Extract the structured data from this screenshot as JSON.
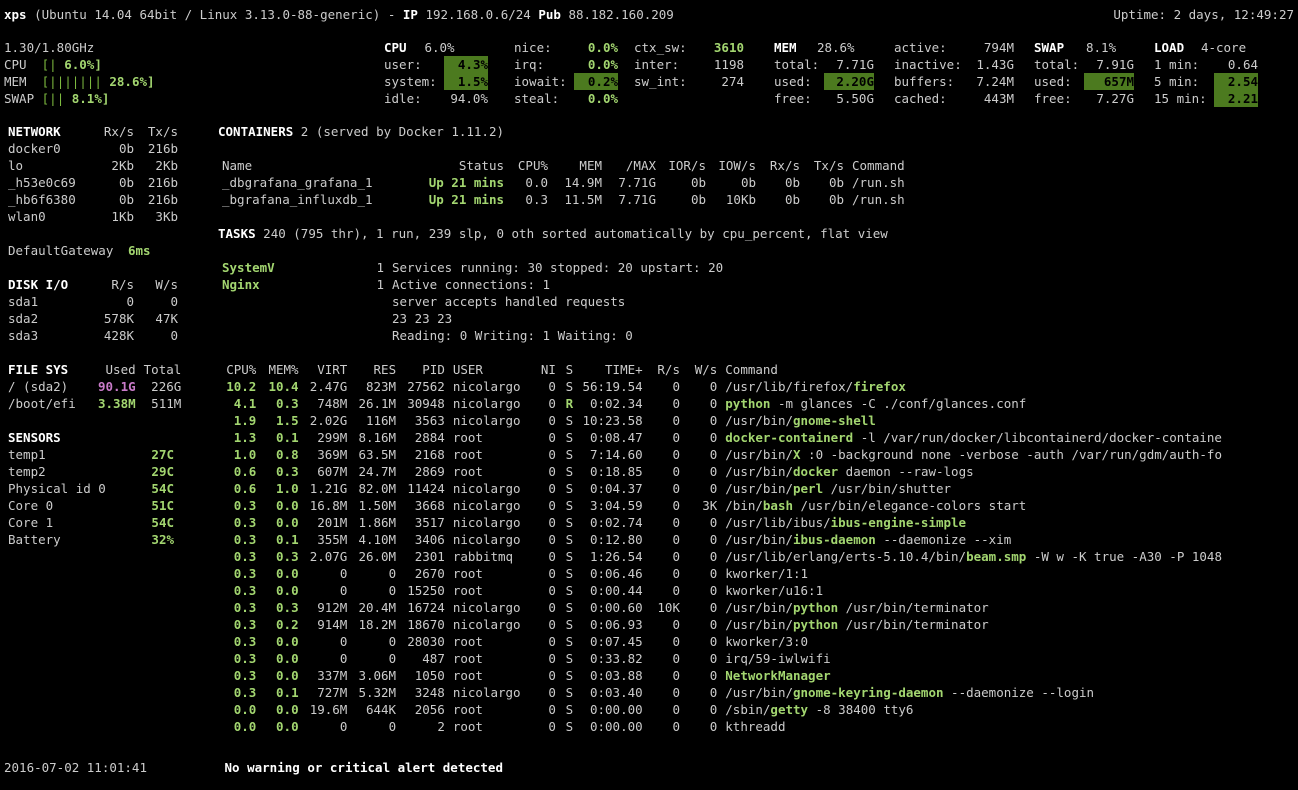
{
  "header": {
    "hostname": "xps",
    "os": "(Ubuntu 14.04 64bit / Linux 3.13.0-88-generic) - ",
    "ip_lbl": "IP",
    "ip": "192.168.0.6/24",
    "pub_lbl": "Pub",
    "pub": "88.182.160.209",
    "uptime": "Uptime: 2 days, 12:49:27"
  },
  "quicklook": {
    "freq": "1.30/1.80GHz",
    "cpu_bar": "[|                       ",
    "cpu_pct": "6.0%]",
    "mem_bar": "[|||||||                 ",
    "mem_pct": "28.6%]",
    "swap_bar": "[||                      ",
    "swap_pct": "8.1%]"
  },
  "cpu": {
    "title": "CPU",
    "total": "6.0%",
    "rows": [
      [
        "user:",
        "4.3%",
        true
      ],
      [
        "system:",
        "1.5%",
        true
      ],
      [
        "idle:",
        "94.0%",
        false
      ]
    ],
    "col2": [
      [
        "nice:",
        "0.0%"
      ],
      [
        "irq:",
        "0.0%"
      ],
      [
        "iowait:",
        "0.2%"
      ],
      [
        "steal:",
        "0.0%"
      ]
    ],
    "col3": [
      [
        "ctx_sw:",
        "3610",
        true
      ],
      [
        "inter:",
        "1198",
        false
      ],
      [
        "sw_int:",
        "274",
        false
      ]
    ]
  },
  "mem": {
    "title": "MEM",
    "total_pct": "28.6%",
    "rows": [
      [
        "total:",
        "7.71G"
      ],
      [
        "used:",
        "2.20G",
        true
      ],
      [
        "free:",
        "5.50G"
      ]
    ],
    "col2": [
      [
        "active:",
        "794M"
      ],
      [
        "inactive:",
        "1.43G"
      ],
      [
        "buffers:",
        "7.24M"
      ],
      [
        "cached:",
        "443M"
      ]
    ]
  },
  "swap": {
    "title": "SWAP",
    "total_pct": "8.1%",
    "rows": [
      [
        "total:",
        "7.91G"
      ],
      [
        "used:",
        "657M",
        true
      ],
      [
        "free:",
        "7.27G"
      ]
    ]
  },
  "load": {
    "title": "LOAD",
    "cores": "4-core",
    "rows": [
      [
        "1 min:",
        "0.64"
      ],
      [
        "5 min:",
        "2.54",
        true
      ],
      [
        "15 min:",
        "2.21",
        true
      ]
    ]
  },
  "network": {
    "title": "NETWORK",
    "hdr": [
      "Rx/s",
      "Tx/s"
    ],
    "rows": [
      [
        "docker0",
        "0b",
        "216b"
      ],
      [
        "lo",
        "2Kb",
        "2Kb"
      ],
      [
        "_h53e0c69",
        "0b",
        "216b"
      ],
      [
        "_hb6f6380",
        "0b",
        "216b"
      ],
      [
        "wlan0",
        "1Kb",
        "3Kb"
      ]
    ],
    "gw": [
      "DefaultGateway",
      "6ms"
    ]
  },
  "diskio": {
    "title": "DISK I/O",
    "hdr": [
      "R/s",
      "W/s"
    ],
    "rows": [
      [
        "sda1",
        "0",
        "0"
      ],
      [
        "sda2",
        "578K",
        "47K"
      ],
      [
        "sda3",
        "428K",
        "0"
      ]
    ]
  },
  "fs": {
    "title": "FILE SYS",
    "hdr": [
      "Used",
      "Total"
    ],
    "rows": [
      [
        "/ (sda2)",
        "90.1G",
        "226G",
        "magenta"
      ],
      [
        "/boot/efi",
        "3.38M",
        "511M",
        "green"
      ]
    ]
  },
  "sensors": {
    "title": "SENSORS",
    "rows": [
      [
        "temp1",
        "27C"
      ],
      [
        "temp2",
        "29C"
      ],
      [
        "Physical id 0",
        "54C"
      ],
      [
        "Core 0",
        "51C"
      ],
      [
        "Core 1",
        "54C"
      ],
      [
        "Battery",
        "32%"
      ]
    ]
  },
  "containers": {
    "title": "CONTAINERS",
    "count": "2",
    "served": "(served by Docker 1.11.2)",
    "hdr": [
      "Name",
      "Status",
      "CPU%",
      "MEM",
      "/MAX",
      "IOR/s",
      "IOW/s",
      "Rx/s",
      "Tx/s",
      "Command"
    ],
    "rows": [
      [
        "_dbgrafana_grafana_1",
        "Up 21 mins",
        "0.0",
        "14.9M",
        "7.71G",
        "0b",
        "0b",
        "0b",
        "0b",
        "/run.sh"
      ],
      [
        "_bgrafana_influxdb_1",
        "Up 21 mins",
        "0.3",
        "11.5M",
        "7.71G",
        "0b",
        "10Kb",
        "0b",
        "0b",
        "/run.sh"
      ]
    ]
  },
  "tasks": {
    "title": "TASKS",
    "summary": "240 (795 thr), 1 run, 239 slp, 0 oth sorted automatically by cpu_percent, flat view"
  },
  "amps": [
    [
      "SystemV",
      "1",
      "Services running: 30 stopped: 20 upstart: 20"
    ],
    [
      "Nginx",
      "1",
      "Active connections: 1"
    ],
    [
      "",
      "",
      "server accepts handled requests"
    ],
    [
      "",
      "",
      " 23 23 23"
    ],
    [
      "",
      "",
      "Reading: 0 Writing: 1 Waiting: 0"
    ]
  ],
  "procs": {
    "hdr": [
      "CPU%",
      "MEM%",
      "VIRT",
      "RES",
      "PID",
      "USER",
      "NI",
      "S",
      "TIME+",
      "R/s",
      "W/s",
      "Command"
    ],
    "rows": [
      [
        "10.2",
        "10.4",
        "2.47G",
        "823M",
        "27562",
        "nicolargo",
        "0",
        "S",
        "56:19.54",
        "0",
        "0",
        [
          "/usr/lib/firefox/",
          [
            "firefox",
            "g"
          ]
        ]
      ],
      [
        "4.1",
        "0.3",
        "748M",
        "26.1M",
        "30948",
        "nicolargo",
        "0",
        "R",
        "0:02.34",
        "0",
        "0",
        [
          [
            "python",
            "g"
          ],
          " -m glances -C ./conf/glances.conf"
        ]
      ],
      [
        "1.9",
        "1.5",
        "2.02G",
        "116M",
        "3563",
        "nicolargo",
        "0",
        "S",
        "10:23.58",
        "0",
        "0",
        [
          "/usr/bin/",
          [
            "gnome-shell",
            "g"
          ]
        ]
      ],
      [
        "1.3",
        "0.1",
        "299M",
        "8.16M",
        "2884",
        "root",
        "0",
        "S",
        "0:08.47",
        "0",
        "0",
        [
          [
            "docker-containerd",
            "g"
          ],
          " -l /var/run/docker/libcontainerd/docker-containe"
        ]
      ],
      [
        "1.0",
        "0.8",
        "369M",
        "63.5M",
        "2168",
        "root",
        "0",
        "S",
        "7:14.60",
        "0",
        "0",
        [
          "/usr/bin/",
          [
            "X",
            "g"
          ],
          " :0 -background none -verbose -auth /var/run/gdm/auth-fo"
        ]
      ],
      [
        "0.6",
        "0.3",
        "607M",
        "24.7M",
        "2869",
        "root",
        "0",
        "S",
        "0:18.85",
        "0",
        "0",
        [
          "/usr/bin/",
          [
            "docker",
            "g"
          ],
          " daemon --raw-logs"
        ]
      ],
      [
        "0.6",
        "1.0",
        "1.21G",
        "82.0M",
        "11424",
        "nicolargo",
        "0",
        "S",
        "0:04.37",
        "0",
        "0",
        [
          "/usr/bin/",
          [
            "perl",
            "g"
          ],
          " /usr/bin/shutter"
        ]
      ],
      [
        "0.3",
        "0.0",
        "16.8M",
        "1.50M",
        "3668",
        "nicolargo",
        "0",
        "S",
        "3:04.59",
        "0",
        "3K",
        [
          "/bin/",
          [
            "bash",
            "g"
          ],
          " /usr/bin/elegance-colors start"
        ]
      ],
      [
        "0.3",
        "0.0",
        "201M",
        "1.86M",
        "3517",
        "nicolargo",
        "0",
        "S",
        "0:02.74",
        "0",
        "0",
        [
          "/usr/lib/ibus/",
          [
            "ibus-engine-simple",
            "g"
          ]
        ]
      ],
      [
        "0.3",
        "0.1",
        "355M",
        "4.10M",
        "3406",
        "nicolargo",
        "0",
        "S",
        "0:12.80",
        "0",
        "0",
        [
          "/usr/bin/",
          [
            "ibus-daemon",
            "g"
          ],
          " --daemonize --xim"
        ]
      ],
      [
        "0.3",
        "0.3",
        "2.07G",
        "26.0M",
        "2301",
        "rabbitmq",
        "0",
        "S",
        "1:26.54",
        "0",
        "0",
        [
          "/usr/lib/erlang/erts-5.10.4/bin/",
          [
            "beam.smp",
            "g"
          ],
          " -W w -K true -A30 -P 1048"
        ]
      ],
      [
        "0.3",
        "0.0",
        "0",
        "0",
        "2670",
        "root",
        "0",
        "S",
        "0:06.46",
        "0",
        "0",
        [
          "kworker/1:1"
        ]
      ],
      [
        "0.3",
        "0.0",
        "0",
        "0",
        "15250",
        "root",
        "0",
        "S",
        "0:00.44",
        "0",
        "0",
        [
          "kworker/u16:1"
        ]
      ],
      [
        "0.3",
        "0.3",
        "912M",
        "20.4M",
        "16724",
        "nicolargo",
        "0",
        "S",
        "0:00.60",
        "10K",
        "0",
        [
          "/usr/bin/",
          [
            "python",
            "g"
          ],
          " /usr/bin/terminator"
        ]
      ],
      [
        "0.3",
        "0.2",
        "914M",
        "18.2M",
        "18670",
        "nicolargo",
        "0",
        "S",
        "0:06.93",
        "0",
        "0",
        [
          "/usr/bin/",
          [
            "python",
            "g"
          ],
          " /usr/bin/terminator"
        ]
      ],
      [
        "0.3",
        "0.0",
        "0",
        "0",
        "28030",
        "root",
        "0",
        "S",
        "0:07.45",
        "0",
        "0",
        [
          "kworker/3:0"
        ]
      ],
      [
        "0.3",
        "0.0",
        "0",
        "0",
        "487",
        "root",
        "0",
        "S",
        "0:33.82",
        "0",
        "0",
        [
          "irq/59-iwlwifi"
        ]
      ],
      [
        "0.3",
        "0.0",
        "337M",
        "3.06M",
        "1050",
        "root",
        "0",
        "S",
        "0:03.88",
        "0",
        "0",
        [
          [
            "NetworkManager",
            "g"
          ]
        ]
      ],
      [
        "0.3",
        "0.1",
        "727M",
        "5.32M",
        "3248",
        "nicolargo",
        "0",
        "S",
        "0:03.40",
        "0",
        "0",
        [
          "/usr/bin/",
          [
            "gnome-keyring-daemon",
            "g"
          ],
          " --daemonize --login"
        ]
      ],
      [
        "0.0",
        "0.0",
        "19.6M",
        "644K",
        "2056",
        "root",
        "0",
        "S",
        "0:00.00",
        "0",
        "0",
        [
          "/sbin/",
          [
            "getty",
            "g"
          ],
          " -8 38400 tty6"
        ]
      ],
      [
        "0.0",
        "0.0",
        "0",
        "0",
        "2",
        "root",
        "0",
        "S",
        "0:00.00",
        "0",
        "0",
        [
          "kthreadd"
        ]
      ]
    ]
  },
  "footer": {
    "ts": "2016-07-02 11:01:41",
    "msg": "No warning or critical alert detected"
  }
}
